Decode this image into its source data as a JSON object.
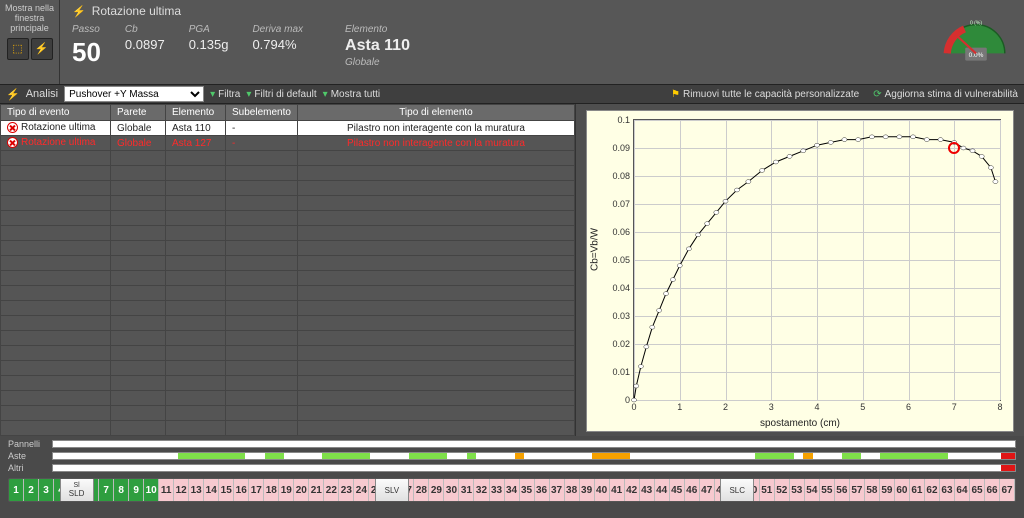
{
  "header": {
    "mostra_label": "Mostra nella finestra principale",
    "title_icon": "bolt",
    "title": "Rotazione ultima",
    "passo_label": "Passo",
    "passo_value": "50",
    "cb_label": "Cb",
    "cb_value": "0.0897",
    "pga_label": "PGA",
    "pga_value": "0.135g",
    "deriva_label": "Deriva max",
    "deriva_value": "0.794%",
    "elemento_label": "Elemento",
    "elemento_value": "Asta 110",
    "elemento_sub": "Globale",
    "gauge": {
      "min": 0,
      "max": 100,
      "value_label": "0.0%",
      "marker_label": "0 (%)"
    }
  },
  "filterbar": {
    "analisi_label": "Analisi",
    "analisi_selected": "Pushover +Y Massa",
    "filtra": "Filtra",
    "filtri_default": "Filtri di default",
    "mostra_tutti": "Mostra tutti",
    "rimuovi": "Rimuovi tutte le capacità personalizzate",
    "aggiorna": "Aggiorna stima di vulnerabilità"
  },
  "table": {
    "headers": {
      "tipo_evento": "Tipo di evento",
      "parete": "Parete",
      "elemento": "Elemento",
      "subelemento": "Subelemento",
      "tipo_elemento": "Tipo di elemento"
    },
    "rows": [
      {
        "sel": true,
        "tipo_evento": "Rotazione ultima",
        "parete": "Globale",
        "elemento": "Asta 110",
        "subelemento": "-",
        "tipo_elemento": "Pilastro non interagente con la muratura"
      },
      {
        "sel": false,
        "tipo_evento": "Rotazione ultima",
        "parete": "Globale",
        "elemento": "Asta 127",
        "subelemento": "-",
        "tipo_elemento": "Pilastro non interagente con la muratura",
        "red": true
      }
    ]
  },
  "chart_data": {
    "type": "line",
    "title": "",
    "xlabel": "spostamento (cm)",
    "ylabel": "Cb=Vb/W",
    "xlim": [
      0,
      8
    ],
    "ylim": [
      0,
      0.1
    ],
    "xticks": [
      0,
      1,
      2,
      3,
      4,
      5,
      6,
      7,
      8
    ],
    "yticks": [
      0,
      0.01,
      0.02,
      0.03,
      0.04,
      0.05,
      0.06,
      0.07,
      0.08,
      0.09,
      0.1
    ],
    "x": [
      0.0,
      0.05,
      0.15,
      0.27,
      0.4,
      0.55,
      0.7,
      0.85,
      1.0,
      1.2,
      1.4,
      1.6,
      1.8,
      2.0,
      2.25,
      2.5,
      2.8,
      3.1,
      3.4,
      3.7,
      4.0,
      4.3,
      4.6,
      4.9,
      5.2,
      5.5,
      5.8,
      6.1,
      6.4,
      6.7,
      7.0,
      7.2,
      7.4,
      7.6,
      7.8,
      7.9
    ],
    "y": [
      0.0,
      0.005,
      0.012,
      0.019,
      0.026,
      0.032,
      0.038,
      0.043,
      0.048,
      0.054,
      0.059,
      0.063,
      0.067,
      0.071,
      0.075,
      0.078,
      0.082,
      0.085,
      0.087,
      0.089,
      0.091,
      0.092,
      0.093,
      0.093,
      0.094,
      0.094,
      0.094,
      0.094,
      0.093,
      0.093,
      0.092,
      0.09,
      0.089,
      0.087,
      0.083,
      0.078
    ],
    "highlight": {
      "x": 7.0,
      "y": 0.09
    }
  },
  "stripes": {
    "rows": [
      "Pannelli",
      "Aste",
      "Altri"
    ],
    "aste_segments": [
      {
        "start": 0.13,
        "end": 0.2,
        "color": "#7fe04a"
      },
      {
        "start": 0.22,
        "end": 0.24,
        "color": "#7fe04a"
      },
      {
        "start": 0.28,
        "end": 0.33,
        "color": "#7fe04a"
      },
      {
        "start": 0.37,
        "end": 0.41,
        "color": "#7fe04a"
      },
      {
        "start": 0.43,
        "end": 0.44,
        "color": "#7fe04a"
      },
      {
        "start": 0.48,
        "end": 0.49,
        "color": "#f6a100"
      },
      {
        "start": 0.56,
        "end": 0.6,
        "color": "#f6a100"
      },
      {
        "start": 0.73,
        "end": 0.77,
        "color": "#7fe04a"
      },
      {
        "start": 0.78,
        "end": 0.79,
        "color": "#f6a100"
      },
      {
        "start": 0.82,
        "end": 0.84,
        "color": "#7fe04a"
      },
      {
        "start": 0.86,
        "end": 0.93,
        "color": "#7fe04a"
      },
      {
        "start": 0.985,
        "end": 1.0,
        "color": "#e01515"
      }
    ],
    "altri_segments": [
      {
        "start": 0.985,
        "end": 1.0,
        "color": "#e01515"
      }
    ]
  },
  "ruler": {
    "count": 67,
    "green_through": 10,
    "tabs": [
      {
        "top": "Sl",
        "bottom": "SLD",
        "pos": 5
      },
      {
        "top": "",
        "bottom": "SLV",
        "pos": 26
      },
      {
        "top": "",
        "bottom": "SLC",
        "pos": 49
      }
    ]
  }
}
